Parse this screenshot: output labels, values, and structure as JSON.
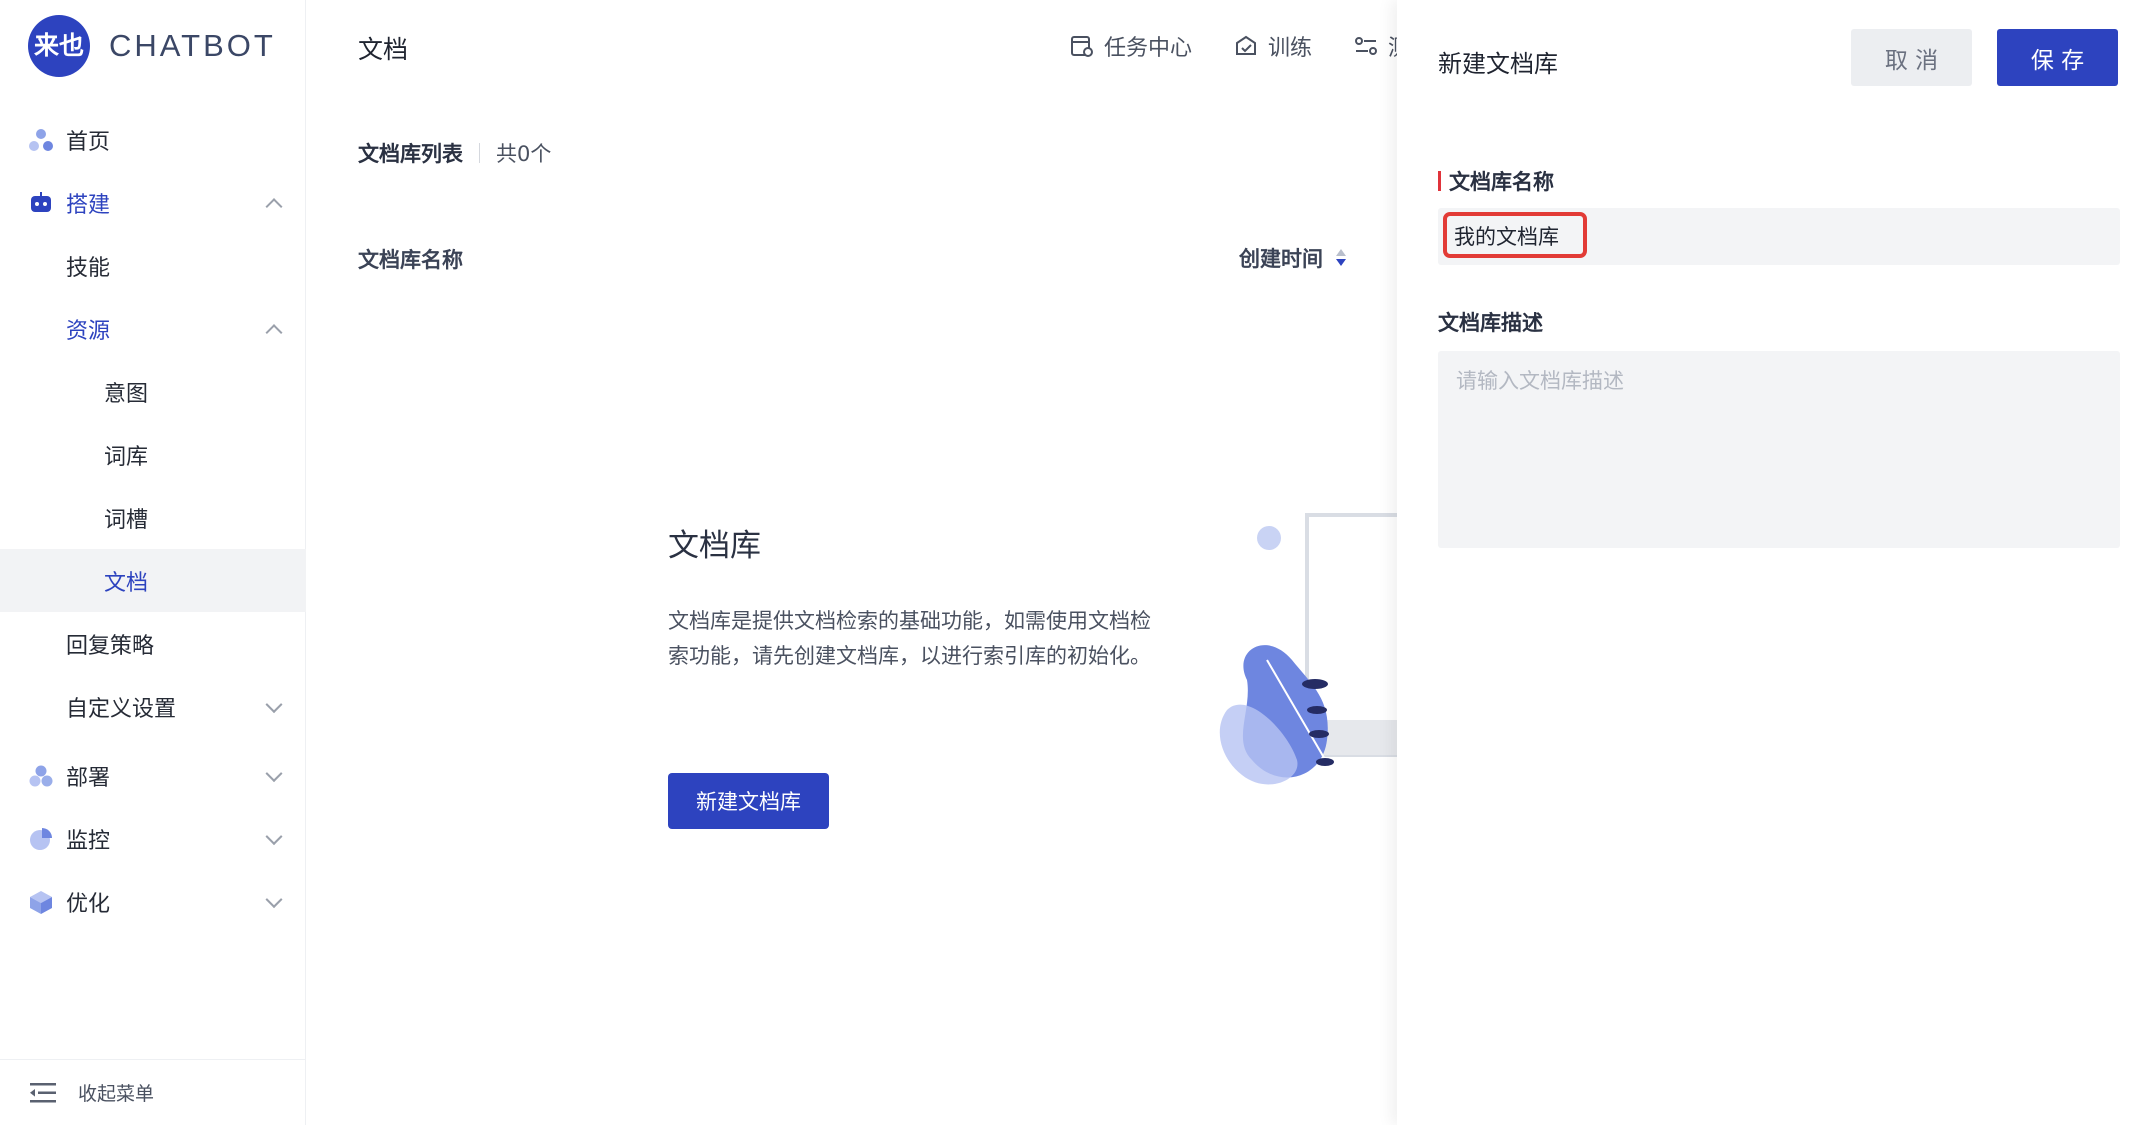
{
  "brand": {
    "logo_text": "来也",
    "name": "CHATBOT"
  },
  "sidebar": {
    "items": [
      {
        "label": "首页"
      },
      {
        "label": "搭建"
      },
      {
        "label": "技能"
      },
      {
        "label": "资源"
      },
      {
        "label": "意图"
      },
      {
        "label": "词库"
      },
      {
        "label": "词槽"
      },
      {
        "label": "文档"
      },
      {
        "label": "回复策略"
      },
      {
        "label": "自定义设置"
      },
      {
        "label": "部署"
      },
      {
        "label": "监控"
      },
      {
        "label": "优化"
      }
    ],
    "footer_label": "收起菜单"
  },
  "main": {
    "title": "文档",
    "top_actions": [
      {
        "label": "任务中心",
        "icon": "task-center-icon"
      },
      {
        "label": "训练",
        "icon": "train-icon"
      },
      {
        "label": "测",
        "icon": "test-icon"
      }
    ],
    "list_title": "文档库列表",
    "list_count": "共0个",
    "columns": {
      "name": "文档库名称",
      "created": "创建时间"
    },
    "empty": {
      "title": "文档库",
      "description": "文档库是提供文档检索的基础功能，如需使用文档检索功能，请先创建文档库，以进行索引库的初始化。",
      "button": "新建文档库"
    }
  },
  "drawer": {
    "title": "新建文档库",
    "cancel_label": "取 消",
    "save_label": "保 存",
    "name_label": "文档库名称",
    "name_value": "我的文档库",
    "desc_label": "文档库描述",
    "desc_placeholder": "请输入文档库描述"
  },
  "colors": {
    "primary": "#2d43bf",
    "required": "#e0333b",
    "highlight": "#e23b36",
    "selected_bg": "#f2f3f5",
    "input_bg": "#f3f4f6"
  }
}
